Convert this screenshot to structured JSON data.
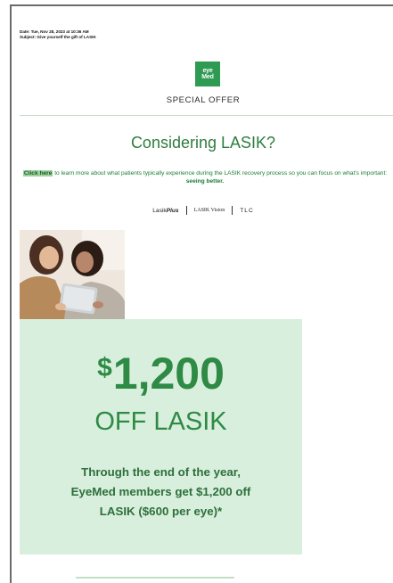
{
  "email": {
    "date_line": "Date: Tue, Nov 28, 2023 at 10:36 AM",
    "subject_line": "Subject: Give yourself the gift of LASIK"
  },
  "logo": {
    "line1": "eye",
    "line2": "Med"
  },
  "special_offer": "SPECIAL OFFER",
  "headline": "Considering LASIK?",
  "paragraph": {
    "link_text": "Click here",
    "text_1": " to learn more about what patients typically experience during the LASIK recovery process so you can focus on what's important: ",
    "emphasis": "seeing better."
  },
  "partners": {
    "p1_a": "Lasik",
    "p1_b": "Plus",
    "p2": "LASIK Vision",
    "p3": "TLC"
  },
  "offer": {
    "currency": "$",
    "amount": "1,200",
    "off_text": "OFF LASIK",
    "detail_1": "Through the end of the year,",
    "detail_2": "EyeMed members get $1,200 off",
    "detail_3": "LASIK ($600 per eye)*"
  },
  "colors": {
    "brand_green": "#2e9a52",
    "offer_bg": "#d8efdd",
    "text_green": "#2e8a44"
  }
}
